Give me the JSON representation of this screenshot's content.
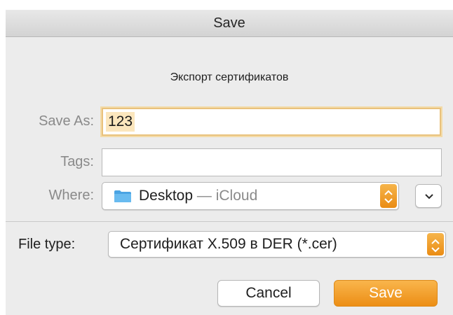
{
  "dialog": {
    "title": "Save",
    "message": "Экспорт сертификатов"
  },
  "save_as": {
    "label": "Save As:",
    "value": "123"
  },
  "tags": {
    "label": "Tags:",
    "value": ""
  },
  "where": {
    "label": "Where:",
    "location_name": "Desktop",
    "location_suffix": " — iCloud",
    "folder_icon": "folder-icon",
    "expand_icon": "chevron-down-icon"
  },
  "file_type": {
    "label": "File type:",
    "selected": "Сертификат X.509 в DER (*.cer)"
  },
  "buttons": {
    "cancel": "Cancel",
    "save": "Save"
  },
  "colors": {
    "accent": "#ec8e15",
    "focus_ring": "#e9c27d",
    "folder": "#5aaee8"
  }
}
